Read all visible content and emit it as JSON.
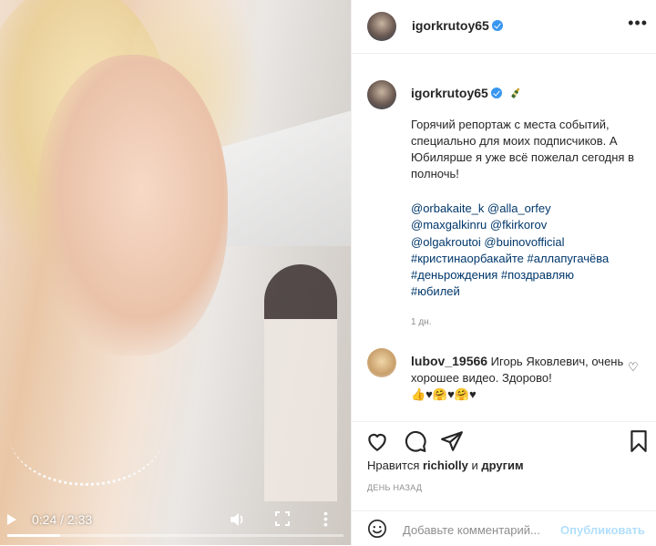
{
  "video": {
    "time": "0:24 / 2:33",
    "progress": 0.157
  },
  "header": {
    "username": "igorkrutoy65",
    "more_icon": "more-horizontal-icon"
  },
  "caption": {
    "username": "igorkrutoy65",
    "text": "Горячий репортаж с места событий, специально для моих подписчиков. А Юбилярше я уже всё пожелал сегодня в полночь!",
    "tag_lines": [
      "@orbakaite_k @alla_orfey",
      "@maxgalkinru @fkirkorov",
      "@olgakroutoi @buinovofficial",
      "#кристинаорбакайте #аллапугачёва",
      "#деньрождения #поздравляю",
      "#юбилей"
    ],
    "age": "1 дн."
  },
  "comment": {
    "username": "lubov_19566",
    "text": " Игорь Яковлевич, очень хорошее видео. Здорово!",
    "emoji_line": "👍♥🤗♥🤗♥"
  },
  "likes": {
    "prefix": "Нравится ",
    "user": "richiolly",
    "suffix": " и ",
    "others": "другим"
  },
  "date": "ДЕНЬ НАЗАД",
  "add_comment": {
    "placeholder": "Добавьте комментарий...",
    "post_label": "Опубликовать"
  },
  "colors": {
    "link": "#00376b",
    "verified": "#3897f0",
    "post_disabled": "#b2dffc",
    "muted": "#8e8e8e"
  }
}
